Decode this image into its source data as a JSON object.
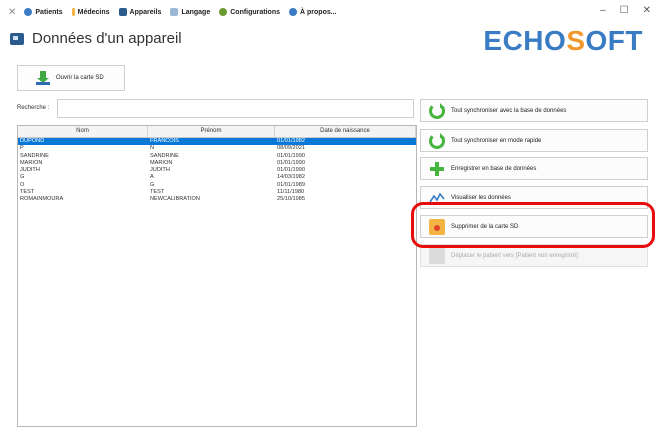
{
  "app": {
    "title": "Données d'un appareil",
    "logo_left": "ECHO",
    "logo_o": "S",
    "logo_right": "OFT"
  },
  "menu": {
    "items": [
      {
        "label": "Patients",
        "icon": "patients-icon",
        "color": "#3a7cc4"
      },
      {
        "label": "Médecins",
        "icon": "doctors-icon",
        "color": "#f2b544"
      },
      {
        "label": "Appareils",
        "icon": "devices-icon",
        "color": "#2b5a8c"
      },
      {
        "label": "Langage",
        "icon": "language-icon",
        "color": "#9bb8d6"
      },
      {
        "label": "Configurations",
        "icon": "gear-icon",
        "color": "#6a9a2f"
      },
      {
        "label": "À propos...",
        "icon": "info-icon",
        "color": "#3a7cc4"
      }
    ]
  },
  "window": {
    "minimize": "–",
    "maximize": "☐",
    "close": "✕"
  },
  "toolbar": {
    "open_sd_label": "Ouvrir la carte SD"
  },
  "search": {
    "label": "Recherche :",
    "value": ""
  },
  "table": {
    "columns": [
      "Nom",
      "Prénom",
      "Date de naissance"
    ],
    "rows": [
      {
        "nom": "DUPOND",
        "prenom": "FRANCOIS",
        "date": "01/01/1982",
        "selected": true
      },
      {
        "nom": "P",
        "prenom": "N",
        "date": "08/09/2021",
        "selected": false
      },
      {
        "nom": "SANDRINE",
        "prenom": "SANDRINE",
        "date": "01/01/1990",
        "selected": false
      },
      {
        "nom": "MARION",
        "prenom": "MARION",
        "date": "01/01/1990",
        "selected": false
      },
      {
        "nom": "JUDITH",
        "prenom": "JUDITH",
        "date": "01/01/1990",
        "selected": false
      },
      {
        "nom": "G",
        "prenom": "A",
        "date": "14/03/1982",
        "selected": false
      },
      {
        "nom": "O",
        "prenom": "G",
        "date": "01/01/1989",
        "selected": false
      },
      {
        "nom": "TEST",
        "prenom": "TEST",
        "date": "11/11/1980",
        "selected": false
      },
      {
        "nom": "ROMAINMOURA",
        "prenom": "NEWCALIBRATION",
        "date": "25/10/1985",
        "selected": false
      }
    ]
  },
  "actions": [
    {
      "label": "Tout synchroniser avec la base de données",
      "icon": "sync-icon",
      "enabled": true
    },
    {
      "label": "Tout synchroniser en mode rapide",
      "icon": "sync-icon",
      "enabled": true
    },
    {
      "label": "Enregistrer en base de données",
      "icon": "plus-icon",
      "enabled": true
    },
    {
      "label": "Visualiser les données",
      "icon": "chart-icon",
      "enabled": true
    },
    {
      "label": "Supprimer de la carte SD",
      "icon": "sd-card-delete-icon",
      "enabled": true
    },
    {
      "label": "Déplacer le patient vers [Patient non enregistré]",
      "icon": "move-icon",
      "enabled": false
    }
  ],
  "colors": {
    "selected_row": "#0a78d7",
    "highlight": "#e80c0c",
    "logo_blue": "#3a7cc4",
    "logo_orange": "#f2992e"
  }
}
